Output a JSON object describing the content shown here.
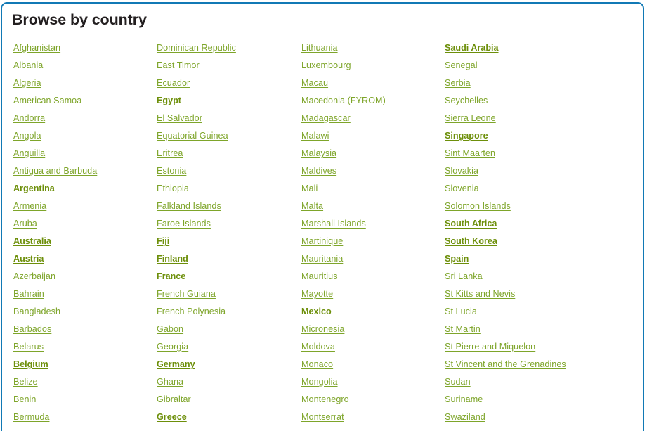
{
  "panel": {
    "title": "Browse by country",
    "border_color": "#1179b5",
    "link_color": "#7ea52a",
    "link_bold_color": "#6d8f0a",
    "title_color": "#231f20"
  },
  "columns": [
    {
      "items": [
        {
          "label": "Afghanistan",
          "bold": false
        },
        {
          "label": "Albania",
          "bold": false
        },
        {
          "label": "Algeria",
          "bold": false
        },
        {
          "label": "American Samoa",
          "bold": false
        },
        {
          "label": "Andorra",
          "bold": false
        },
        {
          "label": "Angola",
          "bold": false
        },
        {
          "label": "Anguilla",
          "bold": false
        },
        {
          "label": "Antigua and Barbuda",
          "bold": false
        },
        {
          "label": "Argentina",
          "bold": true
        },
        {
          "label": "Armenia",
          "bold": false
        },
        {
          "label": "Aruba",
          "bold": false
        },
        {
          "label": "Australia",
          "bold": true
        },
        {
          "label": "Austria",
          "bold": true
        },
        {
          "label": "Azerbaijan",
          "bold": false
        },
        {
          "label": "Bahrain",
          "bold": false
        },
        {
          "label": "Bangladesh",
          "bold": false
        },
        {
          "label": "Barbados",
          "bold": false
        },
        {
          "label": "Belarus",
          "bold": false
        },
        {
          "label": "Belgium",
          "bold": true
        },
        {
          "label": "Belize",
          "bold": false
        },
        {
          "label": "Benin",
          "bold": false
        },
        {
          "label": "Bermuda",
          "bold": false
        }
      ]
    },
    {
      "items": [
        {
          "label": "Dominican Republic",
          "bold": false
        },
        {
          "label": "East Timor",
          "bold": false
        },
        {
          "label": "Ecuador",
          "bold": false
        },
        {
          "label": "Egypt",
          "bold": true
        },
        {
          "label": "El Salvador",
          "bold": false
        },
        {
          "label": "Equatorial Guinea",
          "bold": false
        },
        {
          "label": "Eritrea",
          "bold": false
        },
        {
          "label": "Estonia",
          "bold": false
        },
        {
          "label": "Ethiopia",
          "bold": false
        },
        {
          "label": "Falkland Islands",
          "bold": false
        },
        {
          "label": "Faroe Islands",
          "bold": false
        },
        {
          "label": "Fiji",
          "bold": true
        },
        {
          "label": "Finland",
          "bold": true
        },
        {
          "label": "France",
          "bold": true
        },
        {
          "label": "French Guiana",
          "bold": false
        },
        {
          "label": "French Polynesia",
          "bold": false
        },
        {
          "label": "Gabon",
          "bold": false
        },
        {
          "label": "Georgia",
          "bold": false
        },
        {
          "label": "Germany",
          "bold": true
        },
        {
          "label": "Ghana",
          "bold": false
        },
        {
          "label": "Gibraltar",
          "bold": false
        },
        {
          "label": "Greece",
          "bold": true
        }
      ]
    },
    {
      "items": [
        {
          "label": "Lithuania",
          "bold": false
        },
        {
          "label": "Luxembourg",
          "bold": false
        },
        {
          "label": "Macau",
          "bold": false
        },
        {
          "label": "Macedonia (FYROM)",
          "bold": false
        },
        {
          "label": "Madagascar",
          "bold": false
        },
        {
          "label": "Malawi",
          "bold": false
        },
        {
          "label": "Malaysia",
          "bold": false
        },
        {
          "label": "Maldives",
          "bold": false
        },
        {
          "label": "Mali",
          "bold": false
        },
        {
          "label": "Malta",
          "bold": false
        },
        {
          "label": "Marshall Islands",
          "bold": false
        },
        {
          "label": "Martinique",
          "bold": false
        },
        {
          "label": "Mauritania",
          "bold": false
        },
        {
          "label": "Mauritius",
          "bold": false
        },
        {
          "label": "Mayotte",
          "bold": false
        },
        {
          "label": "Mexico",
          "bold": true
        },
        {
          "label": "Micronesia",
          "bold": false
        },
        {
          "label": "Moldova",
          "bold": false
        },
        {
          "label": "Monaco",
          "bold": false
        },
        {
          "label": "Mongolia",
          "bold": false
        },
        {
          "label": "Montenegro",
          "bold": false
        },
        {
          "label": "Montserrat",
          "bold": false
        }
      ]
    },
    {
      "items": [
        {
          "label": "Saudi Arabia",
          "bold": true
        },
        {
          "label": "Senegal",
          "bold": false
        },
        {
          "label": "Serbia",
          "bold": false
        },
        {
          "label": "Seychelles",
          "bold": false
        },
        {
          "label": "Sierra Leone",
          "bold": false
        },
        {
          "label": "Singapore",
          "bold": true
        },
        {
          "label": "Sint Maarten",
          "bold": false
        },
        {
          "label": "Slovakia",
          "bold": false
        },
        {
          "label": "Slovenia",
          "bold": false
        },
        {
          "label": "Solomon Islands",
          "bold": false
        },
        {
          "label": "South Africa",
          "bold": true
        },
        {
          "label": "South Korea",
          "bold": true
        },
        {
          "label": "Spain",
          "bold": true
        },
        {
          "label": "Sri Lanka",
          "bold": false
        },
        {
          "label": "St Kitts and Nevis",
          "bold": false
        },
        {
          "label": "St Lucia",
          "bold": false
        },
        {
          "label": "St Martin",
          "bold": false
        },
        {
          "label": "St Pierre and Miquelon",
          "bold": false
        },
        {
          "label": "St Vincent and the Grenadines",
          "bold": false
        },
        {
          "label": "Sudan",
          "bold": false
        },
        {
          "label": "Suriname",
          "bold": false
        },
        {
          "label": "Swaziland",
          "bold": false
        }
      ]
    }
  ]
}
